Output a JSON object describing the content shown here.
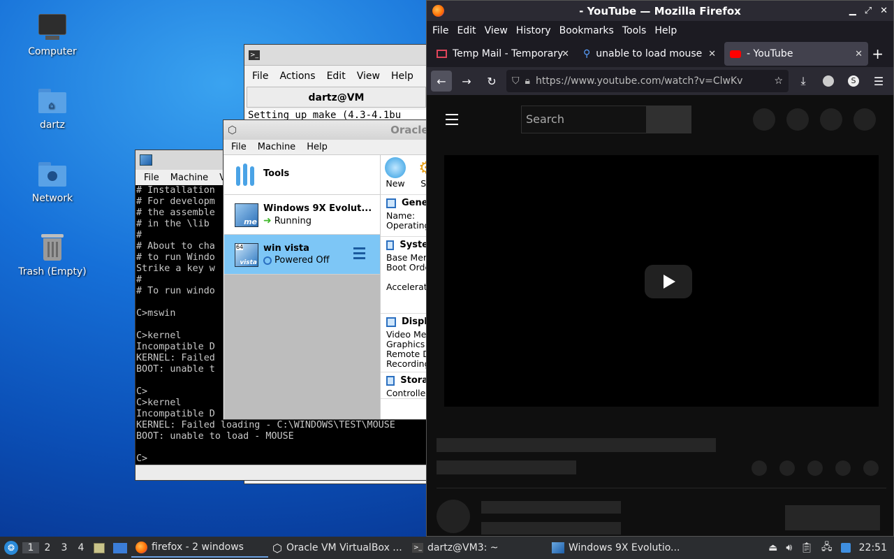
{
  "desktop": {
    "icons": [
      {
        "label": "Computer"
      },
      {
        "label": "dartz"
      },
      {
        "label": "Network"
      },
      {
        "label": "Trash (Empty)"
      }
    ]
  },
  "terminal": {
    "menu": [
      "File",
      "Actions",
      "Edit",
      "View",
      "Help"
    ],
    "header": "dartz@VM",
    "line": "Setting up make (4.3-4.1bu"
  },
  "vm9x": {
    "menu": [
      "File",
      "Machine",
      "Vie"
    ],
    "lines": [
      "# Installation",
      "# For developm",
      "# the assemble",
      "# in the \\lib",
      "#",
      "# About to cha",
      "# to run Windo",
      "Strike a key w",
      "#",
      "# To run windo",
      "",
      "C>mswin",
      "",
      "C>kernel",
      "Incompatible D",
      "KERNEL: Failed",
      "BOOT: unable t",
      "",
      "C>",
      "C>kernel",
      "Incompatible D",
      "KERNEL: Failed loading - C:\\WINDOWS\\TEST\\MOUSE",
      "BOOT: unable to load - MOUSE",
      "",
      "C>"
    ]
  },
  "vbox": {
    "title": "Oracle",
    "menu": [
      "File",
      "Machine",
      "Help"
    ],
    "tools_label": "Tools",
    "vms": [
      {
        "name": "Windows 9X Evolut...",
        "state": "Running"
      },
      {
        "name": "win vista",
        "state": "Powered Off"
      }
    ],
    "toolbar": {
      "new": "New",
      "settings": "Se"
    },
    "sections": [
      {
        "title": "Gene",
        "rows": [
          "Name:",
          "Operating"
        ]
      },
      {
        "title": "Syste",
        "rows": [
          "Base Mem",
          "Boot Orde",
          "",
          "Accelerati"
        ]
      },
      {
        "title": "Displ",
        "rows": [
          "Video Mem",
          "Graphics (",
          "Remote D",
          "Recording"
        ]
      },
      {
        "title": "Stora",
        "rows": [
          "Controller"
        ]
      }
    ]
  },
  "firefox": {
    "title": "- YouTube — Mozilla Firefox",
    "menu": [
      "File",
      "Edit",
      "View",
      "History",
      "Bookmarks",
      "Tools",
      "Help"
    ],
    "tabs": [
      {
        "label": "Temp Mail - Temporary"
      },
      {
        "label": "unable to load mouse"
      },
      {
        "label": "- YouTube"
      }
    ],
    "url": "https://www.youtube.com/watch?v=ClwKv",
    "search_placeholder": "Search"
  },
  "taskbar": {
    "workspaces": [
      "1",
      "2",
      "3",
      "4"
    ],
    "apps": [
      {
        "label": "firefox - 2 windows"
      },
      {
        "label": "Oracle VM VirtualBox ..."
      },
      {
        "label": "dartz@VM3: ~"
      },
      {
        "label": "Windows 9X Evolutio..."
      }
    ],
    "clock": "22:51"
  },
  "colors": {
    "selection": "#7dc6f6",
    "firefox_dark": "#1c1b22",
    "youtube_bg": "#0f0f0f",
    "taskbar": "#2b2d30"
  }
}
